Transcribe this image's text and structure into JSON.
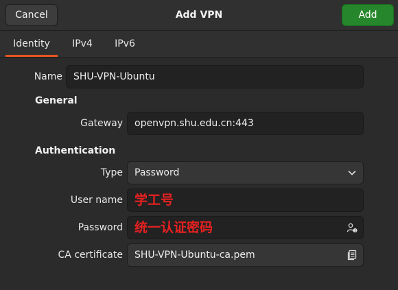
{
  "header": {
    "title": "Add VPN",
    "cancel_label": "Cancel",
    "add_label": "Add",
    "add_color": "#26862b"
  },
  "tabs": [
    {
      "label": "Identity",
      "active": true
    },
    {
      "label": "IPv4",
      "active": false
    },
    {
      "label": "IPv6",
      "active": false
    }
  ],
  "accent": "#e95420",
  "form": {
    "name_label": "Name",
    "name_value": "SHU-VPN-Ubuntu",
    "general_heading": "General",
    "gateway_label": "Gateway",
    "gateway_value": "openvpn.shu.edu.cn:443",
    "auth_heading": "Authentication",
    "type_label": "Type",
    "type_value": "Password",
    "username_label": "User name",
    "username_value": "学工号",
    "password_label": "Password",
    "password_value": "统一认证密码",
    "password_icon": "user-key-icon",
    "ca_label": "CA certificate",
    "ca_value": "SHU-VPN-Ubuntu-ca.pem",
    "ca_icon": "file-chooser-icon",
    "annotation_color": "#e82020"
  }
}
